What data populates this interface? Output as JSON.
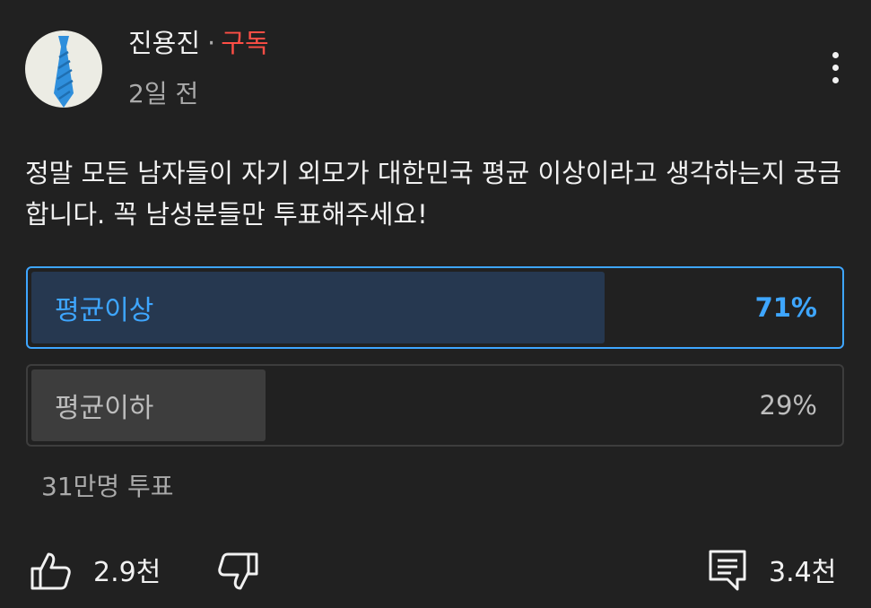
{
  "post": {
    "author": "진용진",
    "separator": "·",
    "subscribe_label": "구독",
    "time": "2일 전",
    "text": "정말 모든 남자들이 자기 외모가 대한민국 평균 이상이라고 생각하는지 궁금합니다. 꼭 남성분들만 투표해주세요!"
  },
  "poll": {
    "options": [
      {
        "label": "평균이상",
        "percent": "71%",
        "fraction": 0.71,
        "selected": true
      },
      {
        "label": "평균이하",
        "percent": "29%",
        "fraction": 0.29,
        "selected": false
      }
    ],
    "vote_count": "31만명 투표"
  },
  "actions": {
    "like_count": "2.9천",
    "comment_count": "3.4천"
  },
  "icons": {
    "more": "more-vertical-icon",
    "like": "thumbs-up-icon",
    "dislike": "thumbs-down-icon",
    "comment": "comment-icon"
  },
  "colors": {
    "background": "#212121",
    "accent": "#3ea6ff",
    "subscribe": "#ff4e45",
    "selected_fill": "#263850",
    "unselected_fill": "#3d3d3d"
  }
}
